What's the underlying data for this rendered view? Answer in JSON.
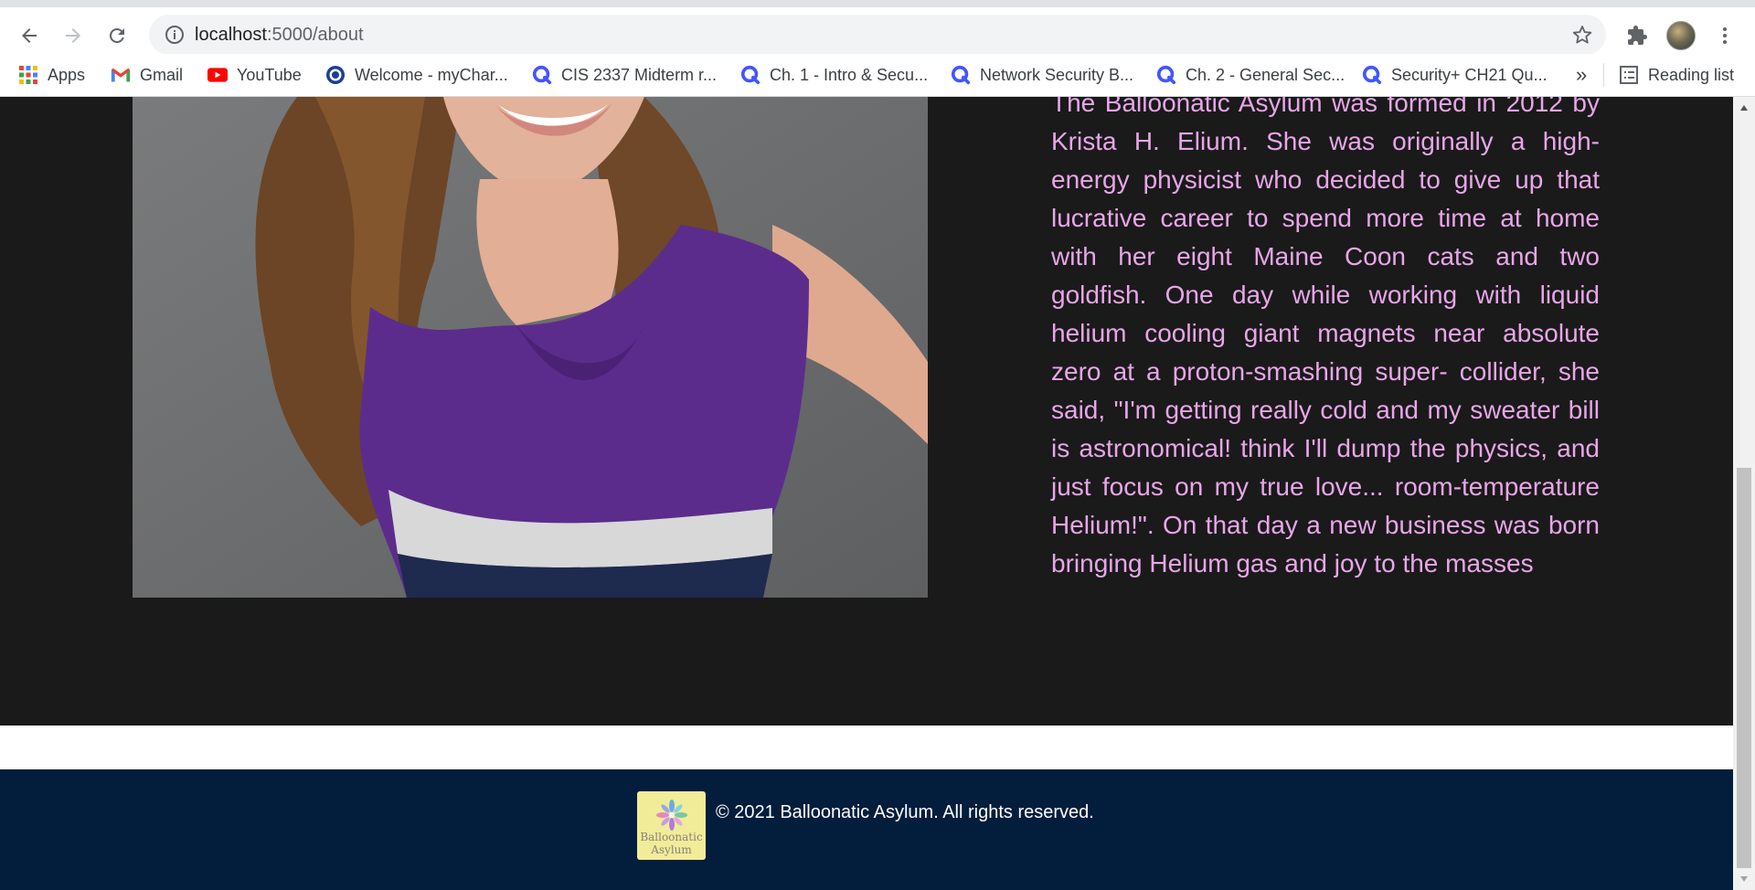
{
  "browser": {
    "url_host": "localhost",
    "url_path": ":5000/about",
    "bookmarks": [
      {
        "label": "Apps",
        "icon": "apps-grid-icon"
      },
      {
        "label": "Gmail",
        "icon": "gmail-icon"
      },
      {
        "label": "YouTube",
        "icon": "youtube-icon"
      },
      {
        "label": "Welcome - myChar...",
        "icon": "mycharter-icon"
      },
      {
        "label": "CIS 2337 Midterm r...",
        "icon": "quizlet-icon"
      },
      {
        "label": "Ch. 1 - Intro & Secu...",
        "icon": "quizlet-icon"
      },
      {
        "label": "Network Security B...",
        "icon": "quizlet-icon"
      },
      {
        "label": "Ch. 2 - General Sec...",
        "icon": "quizlet-icon"
      },
      {
        "label": "Security+ CH21 Qu...",
        "icon": "quizlet-icon"
      }
    ],
    "overflow_label": "»",
    "reading_list_label": "Reading list"
  },
  "about": {
    "paragraph": "The Balloonatic Asylum was formed in 2012 by Krista H. Elium. She was originally a high-energy physicist who decided to give up that lucrative career to spend more time at home with her eight Maine Coon cats and two goldfish. One day while working with liquid helium cooling giant magnets near absolute zero at a proton-smashing super- collider, she said, \"I'm getting really cold and my sweater bill is astronomical! think I'll dump the physics, and just focus on my true love... room-temperature Helium!\". On that day a new business was born bringing Helium gas and joy to the masses"
  },
  "footer": {
    "logo_line1": "Balloonatic",
    "logo_line2": "Asylum",
    "copyright": "© 2021 Balloonatic Asylum. All rights reserved."
  },
  "colors": {
    "page_background": "#1a1a1a",
    "about_text": "#e8a6e8",
    "footer_background": "#031d3d",
    "logo_background": "#f1ec98"
  }
}
